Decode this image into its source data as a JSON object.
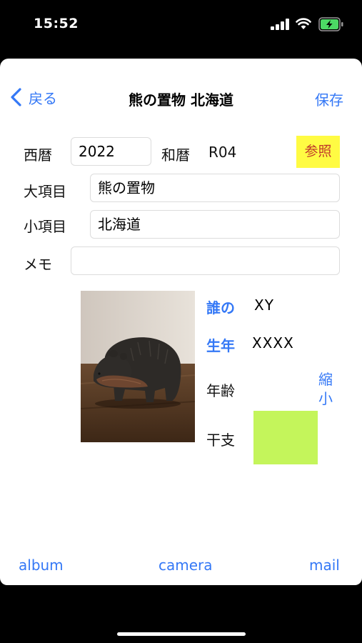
{
  "status_bar": {
    "time": "15:52",
    "signal_icon": "cellular-signal-icon",
    "wifi_icon": "wifi-icon",
    "battery_icon": "battery-charging-icon",
    "battery_color": "#4cd964"
  },
  "nav": {
    "back_label": "戻る",
    "title": "熊の置物 北海道",
    "save_label": "保存",
    "accent_color": "#3478f6"
  },
  "form": {
    "seireki_label": "西暦",
    "seireki_value": "2022",
    "wareki_label": "和暦",
    "wareki_value": "R04",
    "ref_button_label": "参照",
    "major_item_label": "大項目",
    "major_item_value": "熊の置物",
    "minor_item_label": "小項目",
    "minor_item_value": "北海道",
    "memo_label": "メモ",
    "memo_value": ""
  },
  "info": {
    "who_label": "誰の",
    "who_value": "XY",
    "birth_year_label": "生年",
    "birth_year_value": "XXXX",
    "age_label": "年齢",
    "shrink_label": "縮小",
    "zodiac_label": "干支",
    "zodiac_color": "#c4f55b"
  },
  "tabs": {
    "album": "album",
    "camera": "camera",
    "mail": "mail"
  }
}
